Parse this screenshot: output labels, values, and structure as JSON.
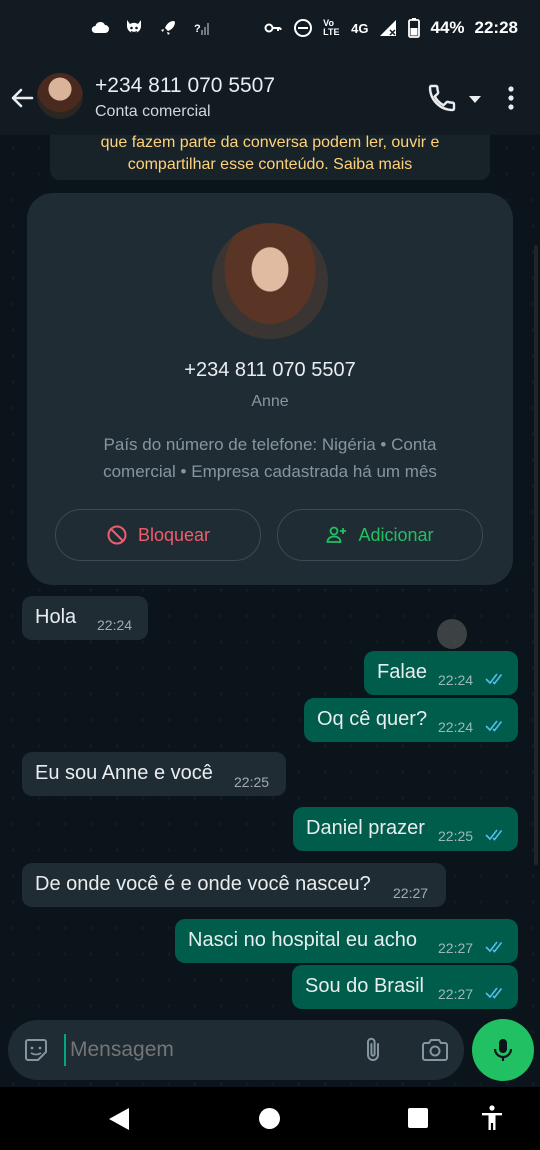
{
  "status_bar": {
    "network_label": "4G",
    "volte_label": "Vo LTE",
    "battery": "44%",
    "time": "22:28"
  },
  "header": {
    "title": "+234 811 070 5507",
    "subtitle": "Conta comercial"
  },
  "encryption_notice": {
    "line1": "que fazem parte da conversa podem ler, ouvir e",
    "line2": "compartilhar esse conteúdo. Saiba mais"
  },
  "contact_card": {
    "phone": "+234 811 070 5507",
    "name": "Anne",
    "info_line1": "País do número de telefone: Nigéria • Conta",
    "info_line2": "comercial • Empresa cadastrada há um mês",
    "block_label": "Bloquear",
    "add_label": "Adicionar"
  },
  "messages": [
    {
      "direction": "in",
      "text": "Hola",
      "time": "22:24"
    },
    {
      "direction": "out",
      "text": "Falae",
      "time": "22:24",
      "read": true
    },
    {
      "direction": "out",
      "text": "Oq cê quer?",
      "time": "22:24",
      "read": true
    },
    {
      "direction": "in",
      "text": "Eu sou Anne e você",
      "time": "22:25"
    },
    {
      "direction": "out",
      "text": "Daniel prazer",
      "time": "22:25",
      "read": true
    },
    {
      "direction": "in",
      "text": "De onde você é e onde você nasceu?",
      "time": "22:27"
    },
    {
      "direction": "out",
      "text": "Nasci no hospital eu acho",
      "time": "22:27",
      "read": true
    },
    {
      "direction": "out",
      "text": "Sou do Brasil",
      "time": "22:27",
      "read": true
    }
  ],
  "composer": {
    "placeholder": "Mensagem"
  },
  "colors": {
    "accent": "#21c063",
    "outgoing_bubble": "#005c4b",
    "incoming_bubble": "#1f2c33",
    "danger": "#f15c6d",
    "read_ticks": "#53bdeb"
  }
}
